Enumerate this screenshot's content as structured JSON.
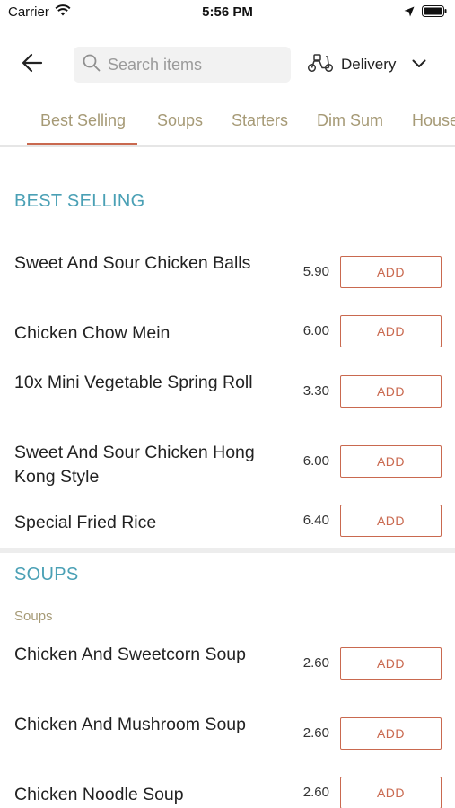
{
  "status_bar": {
    "carrier": "Carrier",
    "time": "5:56 PM"
  },
  "header": {
    "search_placeholder": "Search items",
    "delivery_label": "Delivery"
  },
  "tabs": [
    {
      "label": "Best Selling",
      "active": true
    },
    {
      "label": "Soups",
      "active": false
    },
    {
      "label": "Starters",
      "active": false
    },
    {
      "label": "Dim Sum",
      "active": false
    },
    {
      "label": "House",
      "active": false
    }
  ],
  "sections": [
    {
      "title": "BEST SELLING",
      "subtitle": "",
      "items": [
        {
          "name": "Sweet And Sour Chicken Balls",
          "price": "5.90",
          "button": "ADD"
        },
        {
          "name": "Chicken Chow Mein",
          "price": "6.00",
          "button": "ADD"
        },
        {
          "name": "10x Mini Vegetable Spring Roll",
          "price": "3.30",
          "button": "ADD"
        },
        {
          "name": "Sweet And Sour Chicken Hong Kong Style",
          "price": "6.00",
          "button": "ADD"
        },
        {
          "name": "Special Fried Rice",
          "price": "6.40",
          "button": "ADD"
        }
      ]
    },
    {
      "title": "SOUPS",
      "subtitle": "Soups",
      "items": [
        {
          "name": "Chicken And Sweetcorn Soup",
          "price": "2.60",
          "button": "ADD"
        },
        {
          "name": "Chicken And Mushroom Soup",
          "price": "2.60",
          "button": "ADD"
        },
        {
          "name": "Chicken Noodle Soup",
          "price": "2.60",
          "button": "ADD"
        }
      ]
    }
  ],
  "colors": {
    "accent": "#c9694f",
    "section_title": "#4aa0b5",
    "tab_text": "#a69a76"
  }
}
